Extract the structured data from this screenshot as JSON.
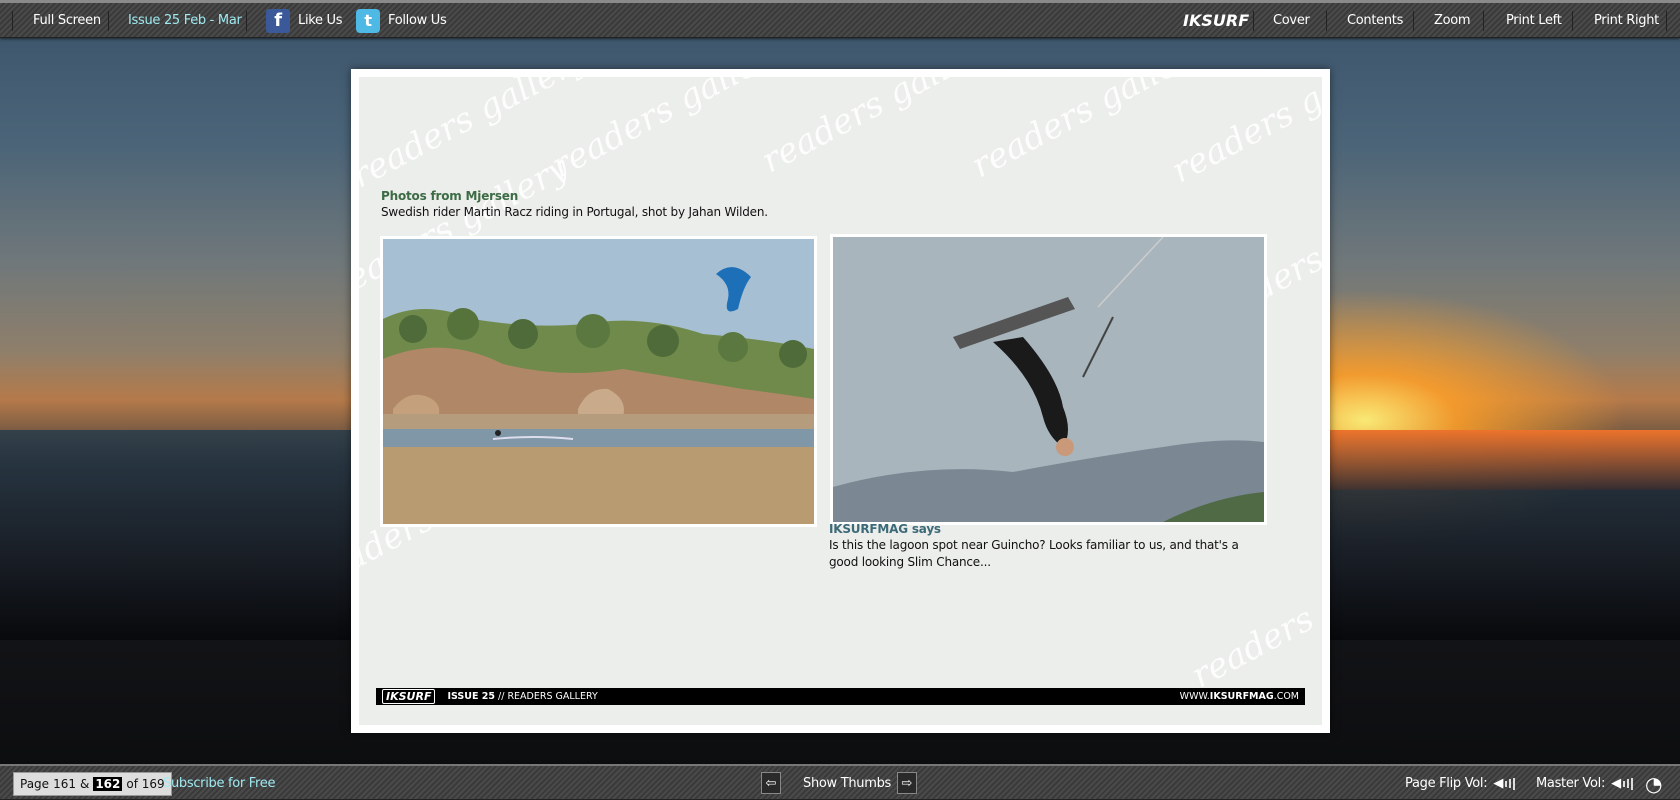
{
  "topbar": {
    "full_screen": "Full Screen",
    "issue": "Issue 25 Feb - Mar",
    "like_us": "Like Us",
    "follow_us": "Follow Us",
    "brand": "IKSURF",
    "cover": "Cover",
    "contents": "Contents",
    "zoom": "Zoom",
    "print_left": "Print Left",
    "print_right": "Print Right"
  },
  "page": {
    "photos_title": "Photos from Mjersen",
    "photos_caption": "Swedish rider Martin Racz riding in Portugal, shot by Jahan Wilden.",
    "says_title": "IKSURFMAG says",
    "says_text": "Is this the lagoon spot near Guincho? Looks familiar to us, and that's a good looking Slim Chance...",
    "watermark": "readers gallery",
    "footer_logo": "IKSURF",
    "footer_issue": "ISSUE 25",
    "footer_section": " // READERS GALLERY",
    "footer_url_pre": "WWW.",
    "footer_url_bold": "IKSURFMAG",
    "footer_url_post": ".COM"
  },
  "bottombar": {
    "page_label": "Page",
    "page_left": "161",
    "amp": "&",
    "page_right": "162",
    "of_label": "of 169",
    "subscribe": "Subscribe for Free",
    "show_thumbs": "Show Thumbs",
    "page_flip_vol": "Page Flip Vol:",
    "master_vol": "Master Vol:"
  },
  "colors": {
    "accent": "#9fe9f0",
    "caption_green": "#3c6b45",
    "says_blue": "#3d6a78"
  }
}
